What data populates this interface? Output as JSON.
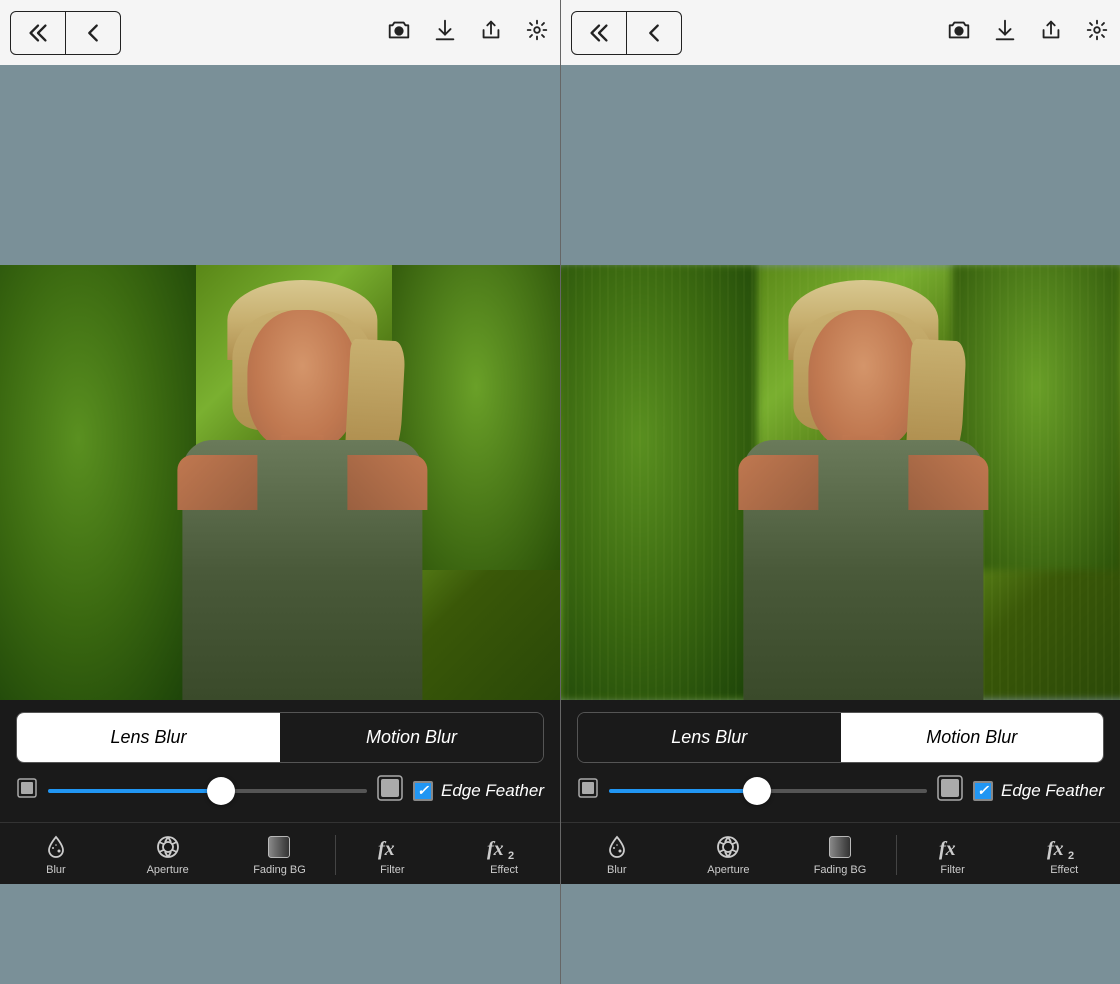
{
  "panels": [
    {
      "id": "left",
      "toolbar": {
        "back_double": "«",
        "back_single": "‹",
        "camera_icon": "📹",
        "download_icon": "⬇",
        "share_icon": "↗",
        "settings_icon": "⚙"
      },
      "blur_tabs": {
        "lens_blur": "Lens Blur",
        "motion_blur": "Motion Blur",
        "active": "lens"
      },
      "edge_feather": {
        "label": "Edge Feather",
        "checked": true
      },
      "slider": {
        "position": 52
      },
      "bottom_nav": [
        {
          "id": "blur",
          "label": "Blur",
          "icon": "blur"
        },
        {
          "id": "aperture",
          "label": "Aperture",
          "icon": "aperture"
        },
        {
          "id": "fading-bg",
          "label": "Fading BG",
          "icon": "fading"
        },
        {
          "id": "filter",
          "label": "Filter",
          "icon": "fx"
        },
        {
          "id": "effect",
          "label": "Effect",
          "icon": "fx2"
        }
      ]
    },
    {
      "id": "right",
      "toolbar": {
        "back_double": "«",
        "back_single": "‹",
        "camera_icon": "📹",
        "download_icon": "⬇",
        "share_icon": "↗",
        "settings_icon": "⚙"
      },
      "blur_tabs": {
        "lens_blur": "Lens Blur",
        "motion_blur": "Motion Blur",
        "active": "motion"
      },
      "edge_feather": {
        "label": "Edge Feather",
        "checked": true
      },
      "slider": {
        "position": 42
      },
      "bottom_nav": [
        {
          "id": "blur",
          "label": "Blur",
          "icon": "blur"
        },
        {
          "id": "aperture",
          "label": "Aperture",
          "icon": "aperture"
        },
        {
          "id": "fading-bg",
          "label": "Fading BG",
          "icon": "fading"
        },
        {
          "id": "filter",
          "label": "Filter",
          "icon": "fx"
        },
        {
          "id": "effect",
          "label": "Effect",
          "icon": "fx2"
        }
      ]
    }
  ]
}
